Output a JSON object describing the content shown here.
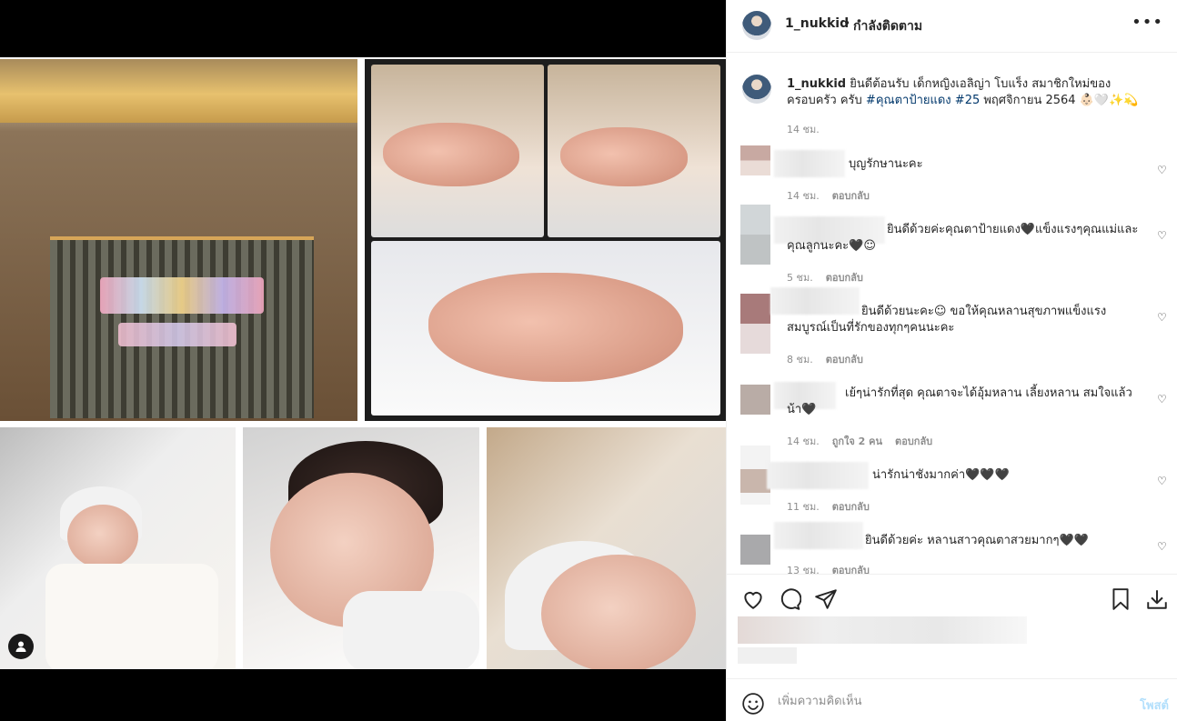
{
  "header": {
    "username": "1_nukkid",
    "separator": "•",
    "following_label": "กำลังติดตาม",
    "more_icon": "more-horizontal-icon"
  },
  "caption": {
    "username": "1_nukkid",
    "text_before": " ยินดีต้อนรับ เด็กหญิงเอลิญ่า โบแร็ง สมาชิกใหม่ของครอบครัว ครับ ",
    "hashtag1": "#คุณตาป้ายแดง",
    "hashtag2": "#25",
    "text_after": " พฤศจิกายน 2564 👶🏻🤍✨💫",
    "time": "14 ชม."
  },
  "comments": [
    {
      "text": "บุญรักษานะคะ",
      "time": "14 ชม.",
      "reply": "ตอบกลับ"
    },
    {
      "text_line1": "ยินดีด้วยค่ะคุณตาป้ายแดง🖤แข็งแรงๆคุณแม่และ",
      "text_line2": "คุณลูกนะคะ🖤☺",
      "time": "5 ชม.",
      "reply": "ตอบกลับ"
    },
    {
      "text_line1": "ยินดีด้วยนะคะ☺ ขอให้คุณหลานสุขภาพแข็งแรง",
      "text_line2": "สมบูรณ์เป็นที่รักของทุกๆคนนะคะ",
      "time": "8 ชม.",
      "reply": "ตอบกลับ"
    },
    {
      "text_line1": "เย้ๆน่ารักที่สุด คุณตาจะได้อุ้มหลาน เลี้ยงหลาน สมใจแล้ว",
      "text_line2": "น้า🖤",
      "time": "14 ชม.",
      "likes": "ถูกใจ 2 คน",
      "reply": "ตอบกลับ"
    },
    {
      "text": "น่ารักน่าชังมากค่า🖤🖤🖤",
      "time": "11 ชม.",
      "reply": "ตอบกลับ"
    },
    {
      "text": "ยินดีด้วยค่ะ หลานสาวคุณตาสวยมากๆ🖤🖤",
      "time": "13 ชม.",
      "reply": "ตอบกลับ"
    }
  ],
  "actions": {
    "like_icon": "heart-icon",
    "comment_icon": "comment-icon",
    "share_icon": "send-icon",
    "save_icon": "bookmark-icon",
    "download_icon": "download-icon"
  },
  "add_comment": {
    "placeholder": "เพิ่มความคิดเห็น",
    "post_label": "โพสต์",
    "emoji_icon": "smiley-icon"
  },
  "media": {
    "user_tag_icon": "user-tag-icon"
  }
}
